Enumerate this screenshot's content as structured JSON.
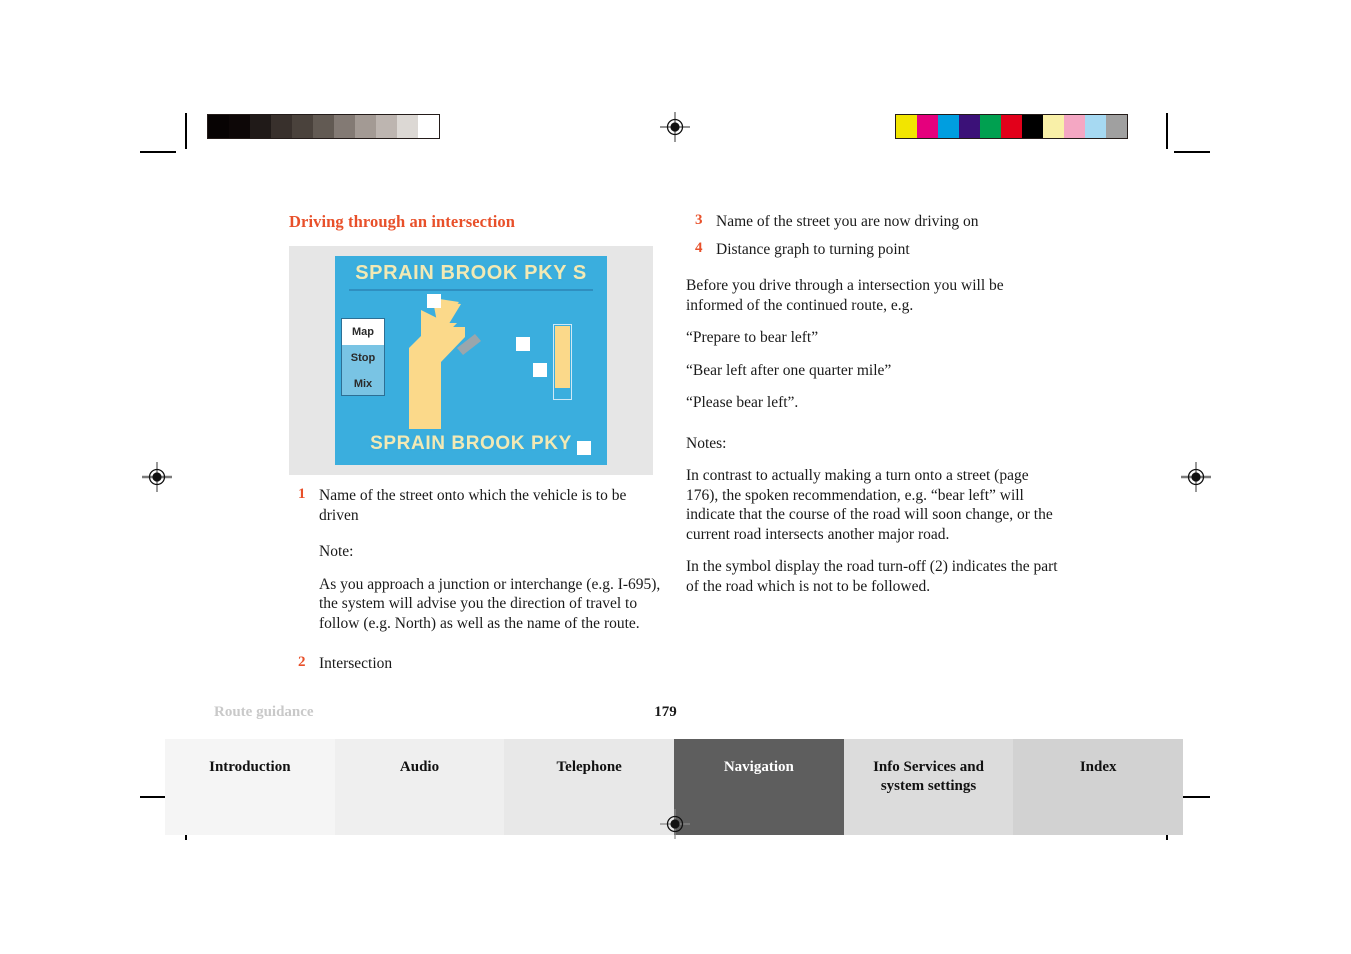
{
  "document": {
    "section_title": "Driving through an intersection",
    "footer_label": "Route guidance",
    "page_number": "179"
  },
  "figure": {
    "caption_alt": "navigation-display",
    "street_top": "SPRAIN BROOK PKY S",
    "street_bottom": "SPRAIN BROOK PKY",
    "buttons": [
      {
        "label": "Map",
        "active": true
      },
      {
        "label": "Stop",
        "active": false
      },
      {
        "label": "Mix",
        "active": false
      }
    ],
    "colors": {
      "screen_blue": "#3aaede",
      "street_text": "#f2e9b4",
      "arrow_yellow": "#fbd98a",
      "figure_background": "#e6e6e6"
    }
  },
  "left_column": {
    "items": [
      {
        "num": "1",
        "text": "Name of the street onto which the vehicle is to be driven"
      }
    ],
    "note_label": "Note:",
    "note_text": "As you approach a junction or interchange (e.g. I-695), the system will advise you the direction of travel to follow (e.g. North) as well as the name of the route.",
    "item2": {
      "num": "2",
      "text": "Intersection"
    }
  },
  "right_column": {
    "items": [
      {
        "num": "3",
        "text": "Name of the street you are now driving on"
      },
      {
        "num": "4",
        "text": "Distance graph to turning point"
      }
    ],
    "intro": "Before you drive through a intersection you will be informed of the continued route, e.g.",
    "quotes": [
      "“Prepare to bear left”",
      "“Bear left after one quarter mile”",
      "“Please bear left”."
    ],
    "notes_label": "Notes:",
    "notes": [
      "In contrast to actually making a turn onto a street (page 176), the spoken recommendation, e.g. “bear left” will indicate that the course of the road will soon change, or the current road intersects another major road.",
      "In the symbol display the road turn-off (2) indicates the part of the road which is not to be followed."
    ]
  },
  "tabs": [
    {
      "label": "Introduction",
      "active": false,
      "bg": "#f5f5f5"
    },
    {
      "label": "Audio",
      "active": false,
      "bg": "#efefef"
    },
    {
      "label": "Telephone",
      "active": false,
      "bg": "#e8e8e8"
    },
    {
      "label": "Navigation",
      "active": true,
      "bg": "#5e5e5e"
    },
    {
      "label": "Info Services and\nsystem settings",
      "active": false,
      "bg": "#dcdcdc"
    },
    {
      "label": "Index",
      "active": false,
      "bg": "#d2d2d2"
    }
  ],
  "print_marks": {
    "grayscale_swatches": [
      "#070303",
      "#0d0707",
      "#201a18",
      "#38302c",
      "#4a423c",
      "#625a53",
      "#837a74",
      "#a39a94",
      "#bdb5b0",
      "#dcd8d4",
      "#ffffff"
    ],
    "color_swatches": [
      "#f2e500",
      "#e5007d",
      "#009ee0",
      "#3b1178",
      "#00a050",
      "#e2001a",
      "#000000",
      "#f9f0a8",
      "#f4a7c3",
      "#a6d9f2",
      "#a0a0a0"
    ]
  }
}
